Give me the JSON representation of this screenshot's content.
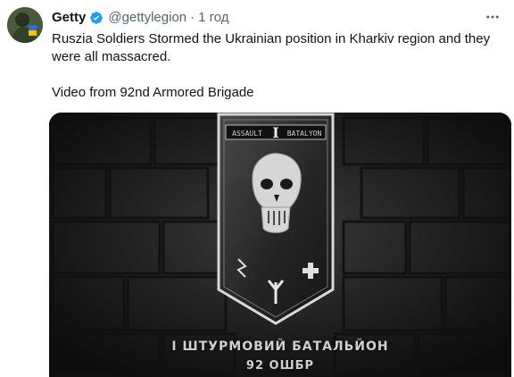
{
  "tweet": {
    "author_name": "Getty",
    "handle": "@gettylegion",
    "separator": "·",
    "time": "1 год",
    "more_icon": "more-horizontal-icon",
    "text_line1": "Ruszia Soldiers Stormed the Ukrainian position in Kharkiv region and they were all massacred.",
    "text_line2": "Video from 92nd Armored Brigade"
  },
  "media": {
    "banner_top_left": "ASSAULT",
    "banner_top_right": "BATALYON",
    "banner_numeral": "I",
    "caption_line1": "І ШТУРМОВИЙ БАТАЛЬЙОН",
    "caption_line2": "92 ОШБР"
  },
  "colors": {
    "verified": "#1d9bf0",
    "text": "#0f1419",
    "secondary": "#536471"
  }
}
